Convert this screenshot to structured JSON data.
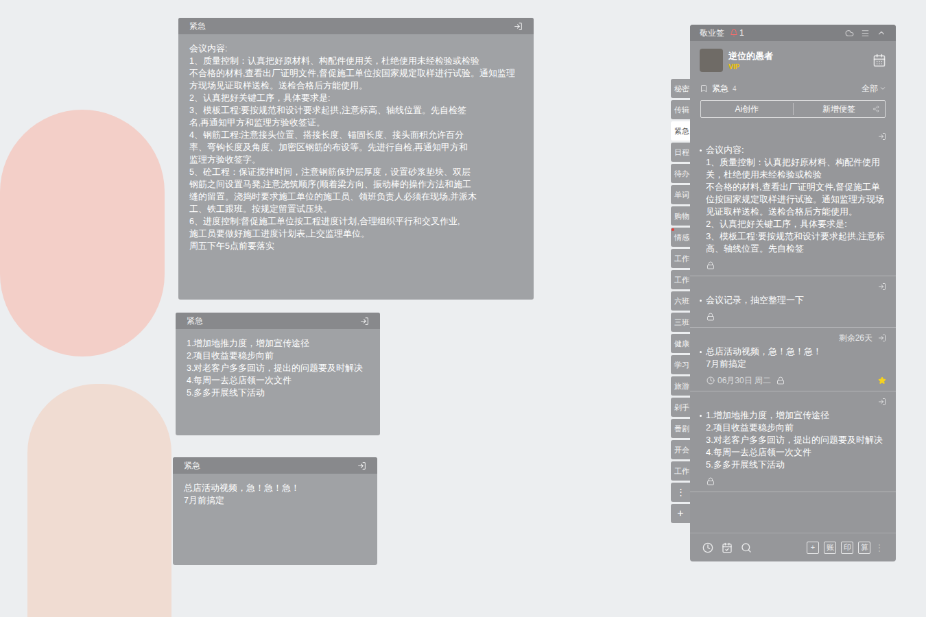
{
  "notes": [
    {
      "title": "紧急",
      "lines": [
        "会议内容:",
        "1、质量控制：认真把好原材料、构配件使用关，杜绝使用未经检验或检验",
        "不合格的材料,查看出厂证明文件,督促施工单位按国家规定取样进行试验。通知监理",
        "方现场见证取样送检。送检合格后方能使用。",
        "2、认真把好关键工序，具体要求是:",
        "3、模板工程:要按规范和设计要求起拱,注意标高、轴线位置。先自检签",
        "名,再通知甲方和监理方验收签证。",
        "4、钢筋工程:注意接头位置、搭接长度、锚固长度、接头面积允许百分",
        "率、弯钩长度及角度、加密区钢筋的布设等。先进行自检,再通知甲方和",
        "监理方验收签字。",
        "5、砼工程：保证搅拌时间，注意钢筋保护层厚度，设置砂浆垫块、双层",
        "钢筋之间设置马凳,注意浇筑顺序(顺着梁方向、振动棒的操作方法和施工",
        "缝的留置。浇捣时要求施工单位的施工员、领班负责人必须在现场,并派木",
        "工、铁工跟班。按规定留置试压块。",
        "6、进度控制:督促施工单位按工程进度计划,合理组织平行和交叉作业,",
        "施工员要做好施工进度计划表,上交监理单位。",
        "周五下午5点前要落实"
      ]
    },
    {
      "title": "紧急",
      "lines": [
        "1.增加地推力度，增加宣传途径",
        "2.项目收益要稳步向前",
        "3.对老客户多多回访，提出的问题要及时解决",
        "4.每周一去总店领一次文件",
        "5.多多开展线下活动"
      ]
    },
    {
      "title": "紧急",
      "lines": [
        "总店活动视频，急！急！急！",
        "7月前搞定"
      ]
    }
  ],
  "app": {
    "title": "敬业签",
    "notification_count": "1",
    "user": {
      "name": "逆位的愚者",
      "badge": "VIP"
    },
    "category": {
      "name": "紧急",
      "count": "4",
      "filter": "全部"
    },
    "actions": [
      "Ai创作",
      "新增便签"
    ],
    "tabs": [
      {
        "label": "秘密",
        "selected": false,
        "dot": false
      },
      {
        "label": "传辑",
        "selected": false,
        "dot": false
      },
      {
        "label": "紧急",
        "selected": true,
        "dot": false
      },
      {
        "label": "日程",
        "selected": false,
        "dot": false
      },
      {
        "label": "待办",
        "selected": false,
        "dot": false
      },
      {
        "label": "单词",
        "selected": false,
        "dot": false
      },
      {
        "label": "购物",
        "selected": false,
        "dot": false
      },
      {
        "label": "情感",
        "selected": false,
        "dot": true
      },
      {
        "label": "工作",
        "selected": false,
        "dot": false
      },
      {
        "label": "工作",
        "selected": false,
        "dot": false
      },
      {
        "label": "六班",
        "selected": false,
        "dot": false
      },
      {
        "label": "三班",
        "selected": false,
        "dot": false
      },
      {
        "label": "健康",
        "selected": false,
        "dot": false
      },
      {
        "label": "学习",
        "selected": false,
        "dot": false
      },
      {
        "label": "旅游",
        "selected": false,
        "dot": false
      },
      {
        "label": "剁手",
        "selected": false,
        "dot": false
      },
      {
        "label": "番剧",
        "selected": false,
        "dot": false
      },
      {
        "label": "开会",
        "selected": false,
        "dot": false
      },
      {
        "label": "工作",
        "selected": false,
        "dot": false
      }
    ],
    "tab_more": "⋮",
    "tab_add": "+",
    "items": [
      {
        "lines": [
          "会议内容:",
          "1、质量控制：认真把好原材料、构配件使用关，杜绝使用未经检验或检验",
          "不合格的材料,查看出厂证明文件,督促施工单位按国家规定取样进行试验。通知监理方现场见证取样送检。送检合格后方能使用。",
          "2、认真把好关键工序，具体要求是:",
          "3、模板工程:要按规范和设计要求起拱,注意标高、轴线位置。先自检签"
        ],
        "starred": false
      },
      {
        "lines": [
          "会议记录，抽空整理一下"
        ],
        "starred": false
      },
      {
        "remaining": "剩余26天",
        "lines": [
          "总店活动视频，急！急！急！",
          "7月前搞定"
        ],
        "date": "06月30日 周二",
        "starred": true
      },
      {
        "lines": [
          "1.增加地推力度，增加宣传途径",
          "2.项目收益要稳步向前",
          "3.对老客户多多回访，提出的问题要及时解决",
          "4.每周一去总店领一次文件",
          "5.多多开展线下活动"
        ],
        "starred": false
      }
    ],
    "toolbar_buttons": [
      "+",
      "账",
      "印",
      "算"
    ],
    "toolbar_more": "⋮"
  }
}
